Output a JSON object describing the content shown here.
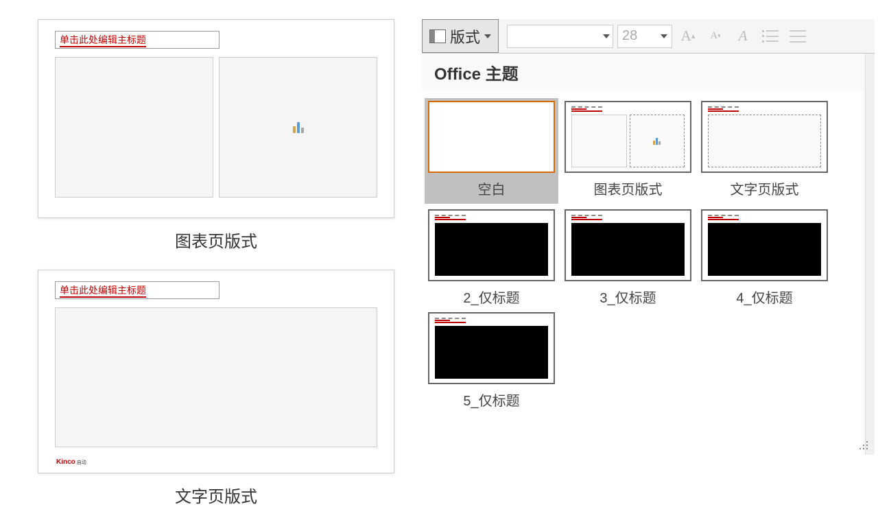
{
  "left": {
    "slide1": {
      "title_placeholder": "单击此处编辑主标题",
      "label": "图表页版式"
    },
    "slide2": {
      "title_placeholder": "单击此处编辑主标题",
      "brand": "Kinco",
      "brand_suffix": "自动",
      "label": "文字页版式"
    }
  },
  "ribbon": {
    "layout_label": "版式",
    "font_size": "28"
  },
  "panel": {
    "section": "Office 主题",
    "layouts": [
      {
        "name": "空白"
      },
      {
        "name": "图表页版式"
      },
      {
        "name": "文字页版式"
      },
      {
        "name": "2_仅标题"
      },
      {
        "name": "3_仅标题"
      },
      {
        "name": "4_仅标题"
      },
      {
        "name": "5_仅标题"
      }
    ]
  }
}
